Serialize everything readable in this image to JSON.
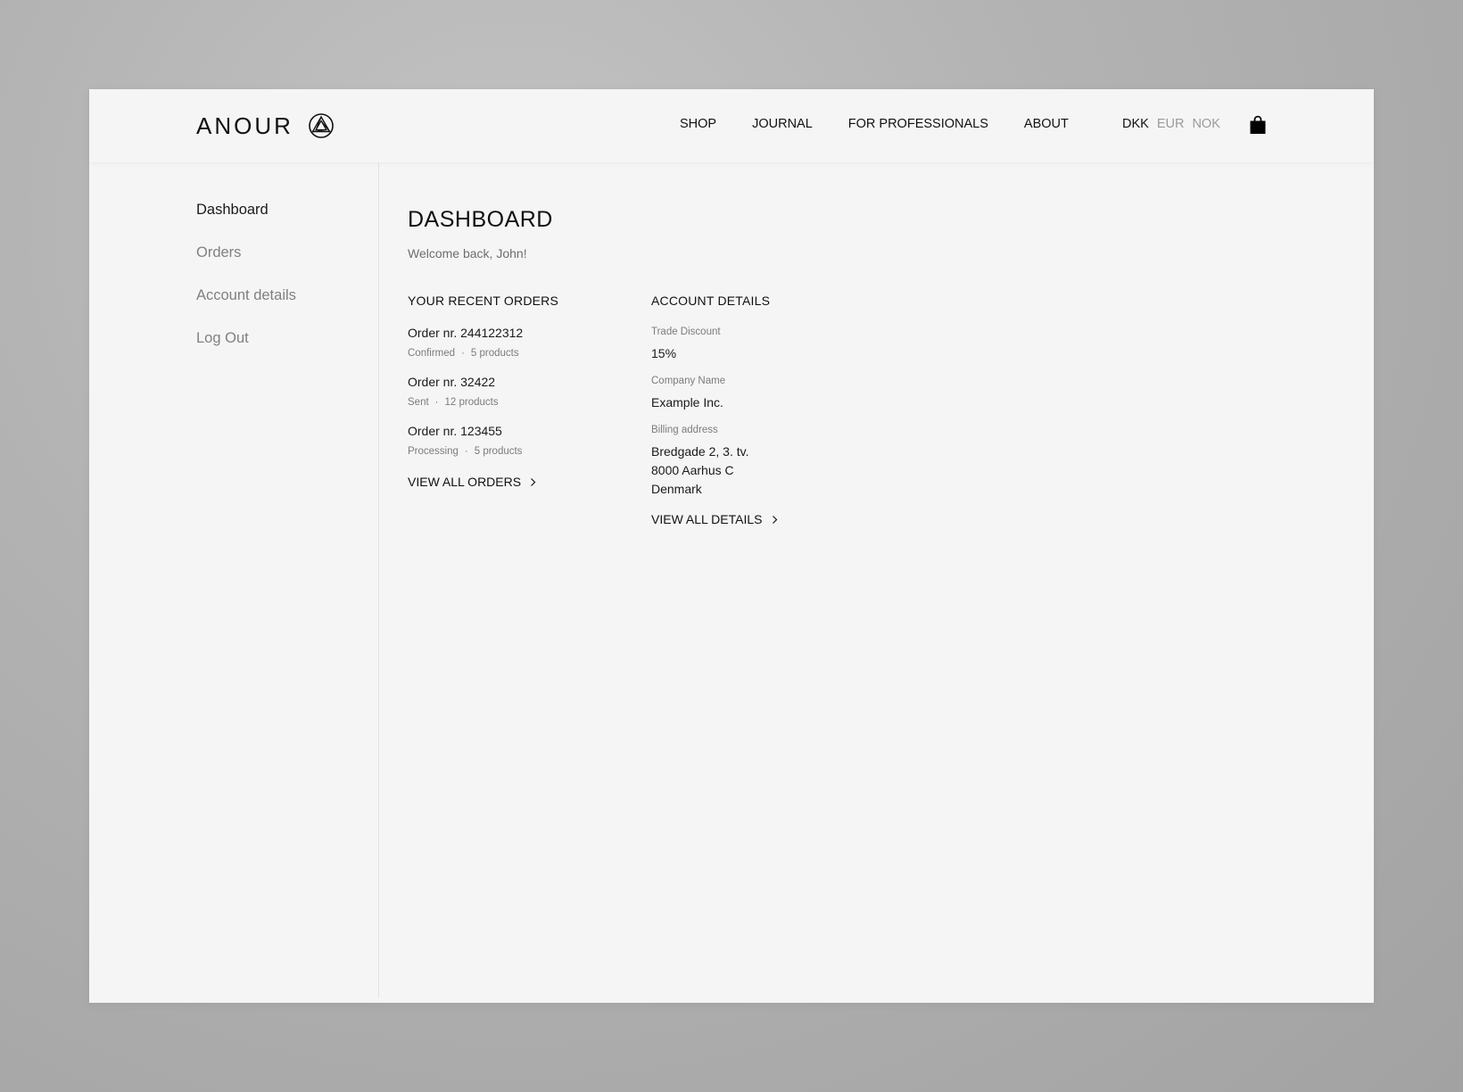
{
  "brand": {
    "name": "ANOUR"
  },
  "nav": {
    "items": [
      {
        "label": "SHOP"
      },
      {
        "label": "JOURNAL"
      },
      {
        "label": "FOR PROFESSIONALS"
      },
      {
        "label": "ABOUT"
      }
    ]
  },
  "currency": {
    "options": [
      {
        "label": "DKK",
        "selected": true
      },
      {
        "label": "EUR",
        "selected": false
      },
      {
        "label": "NOK",
        "selected": false
      }
    ]
  },
  "sidebar": {
    "items": [
      {
        "label": "Dashboard",
        "active": true
      },
      {
        "label": "Orders",
        "active": false
      },
      {
        "label": "Account details",
        "active": false
      },
      {
        "label": "Log Out",
        "active": false
      }
    ]
  },
  "main": {
    "title": "DASHBOARD",
    "welcome": "Welcome back, John!",
    "recent_orders": {
      "title": "YOUR RECENT ORDERS",
      "orders": [
        {
          "title": "Order nr. 244122312",
          "status": "Confirmed",
          "separator": "·",
          "products": "5 products"
        },
        {
          "title": "Order nr. 32422",
          "status": "Sent",
          "separator": "·",
          "products": "12 products"
        },
        {
          "title": "Order nr. 123455",
          "status": "Processing",
          "separator": "·",
          "products": "5 products"
        }
      ],
      "view_all": "VIEW ALL ORDERS"
    },
    "account_details": {
      "title": "ACCOUNT DETAILS",
      "trade_discount_label": "Trade Discount",
      "trade_discount": "15%",
      "company_label": "Company Name",
      "company": "Example Inc.",
      "billing_label": "Billing address",
      "billing_lines": [
        "Bredgade 2, 3. tv.",
        "8000 Aarhus C",
        "Denmark"
      ],
      "view_all": "VIEW ALL DETAILS"
    }
  },
  "icons": {
    "logo": "triangle-emblem-icon",
    "cart": "shopping-bag-icon",
    "chevron": "chevron-right-icon"
  }
}
